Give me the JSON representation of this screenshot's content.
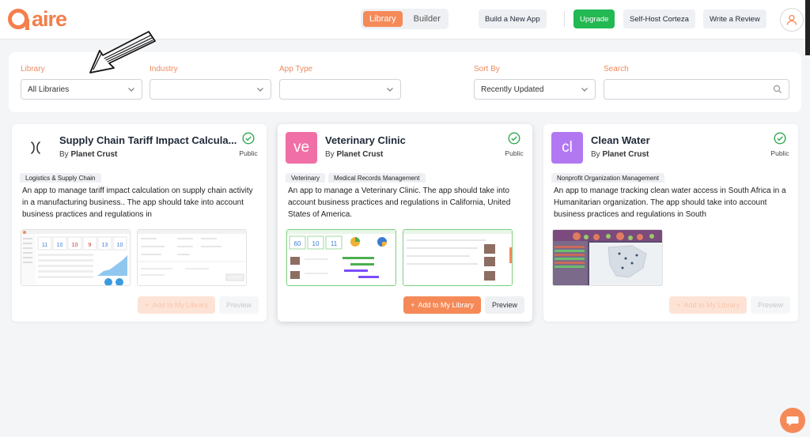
{
  "header": {
    "logo_text": "aire",
    "tabs": [
      {
        "label": "Library",
        "active": true
      },
      {
        "label": "Builder",
        "active": false
      }
    ],
    "build_label": "Build a New App",
    "upgrade_label": "Upgrade",
    "selfhost_label": "Self-Host Corteza",
    "review_label": "Write a Review"
  },
  "filters": {
    "library": {
      "label": "Library",
      "value": "All Libraries"
    },
    "industry": {
      "label": "Industry",
      "value": ""
    },
    "app_type": {
      "label": "App Type",
      "value": ""
    },
    "sort_by": {
      "label": "Sort By",
      "value": "Recently Updated"
    },
    "search": {
      "label": "Search",
      "placeholder": ""
    }
  },
  "cards": [
    {
      "title": "Supply Chain Tariff Impact Calcula...",
      "by": "By",
      "author": "Planet Crust",
      "icon_text": "",
      "visibility": "Public",
      "tags": [
        "Logistics & Supply Chain"
      ],
      "description": "An app to manage tariff impact calculation on supply chain activity in a manufacturing business.. The app should take into account business practices and regulations in",
      "add_label": "Add to My Library",
      "preview_label": "Preview"
    },
    {
      "title": "Veterinary Clinic",
      "by": "By",
      "author": "Planet Crust",
      "icon_text": "ve",
      "visibility": "Public",
      "tags": [
        "Veterinary",
        "Medical Records Management"
      ],
      "description": "An app to manage a Veterinary Clinic. The app should take into account business practices and regulations in California, United States of America.",
      "add_label": "Add to My Library",
      "preview_label": "Preview"
    },
    {
      "title": "Clean Water",
      "by": "By",
      "author": "Planet Crust",
      "icon_text": "cl",
      "visibility": "Public",
      "tags": [
        "Nonprofit Organization Management"
      ],
      "description": "An app to manage tracking clean water access in South Africa in a Humanitarian organization. The app should take into account business practices and regulations in South",
      "add_label": "Add to My Library",
      "preview_label": "Preview"
    }
  ],
  "screenshot_numbers": {
    "supply": [
      "11",
      "10",
      "10",
      "9",
      "13",
      "10"
    ],
    "vet": [
      "60",
      "10",
      "11"
    ]
  },
  "colors": {
    "accent": "#f58a58",
    "upgrade": "#22b852",
    "vet_icon": "#f06fa6",
    "water_icon": "#b278f2",
    "public_check": "#2fa84f"
  },
  "icons": {
    "user": "user-icon",
    "chat": "chat-icon",
    "check": "check-circle-icon",
    "chevron": "chevron-down-icon",
    "search": "search-icon"
  }
}
